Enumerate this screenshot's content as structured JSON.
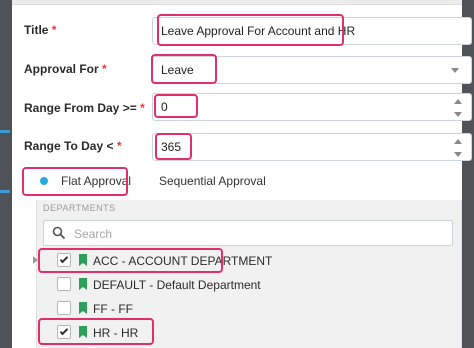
{
  "form": {
    "title": {
      "label": "Title",
      "required": "*",
      "value": "Leave Approval For Account and HR"
    },
    "approval_for": {
      "label": "Approval For",
      "required": "*",
      "value": "Leave"
    },
    "range_from": {
      "label": "Range From Day >=",
      "required": "*",
      "value": "0"
    },
    "range_to": {
      "label": "Range To Day <",
      "required": "*",
      "value": "365"
    }
  },
  "approval_type": {
    "options": [
      {
        "label": "Flat Approval",
        "selected": true
      },
      {
        "label": "Sequential Approval",
        "selected": false
      }
    ]
  },
  "departments": {
    "section_title": "DEPARTMENTS",
    "search_placeholder": "Search",
    "items": [
      {
        "label": "ACC - ACCOUNT DEPARTMENT",
        "checked": true
      },
      {
        "label": "DEFAULT - Default Department",
        "checked": false
      },
      {
        "label": "FF - FF",
        "checked": false
      },
      {
        "label": "HR - HR",
        "checked": true
      }
    ]
  },
  "colors": {
    "highlight": "#e0306a",
    "radio_accent": "#29a8df",
    "required": "#e53935",
    "bookmark_icon": "#2e9e5b"
  }
}
